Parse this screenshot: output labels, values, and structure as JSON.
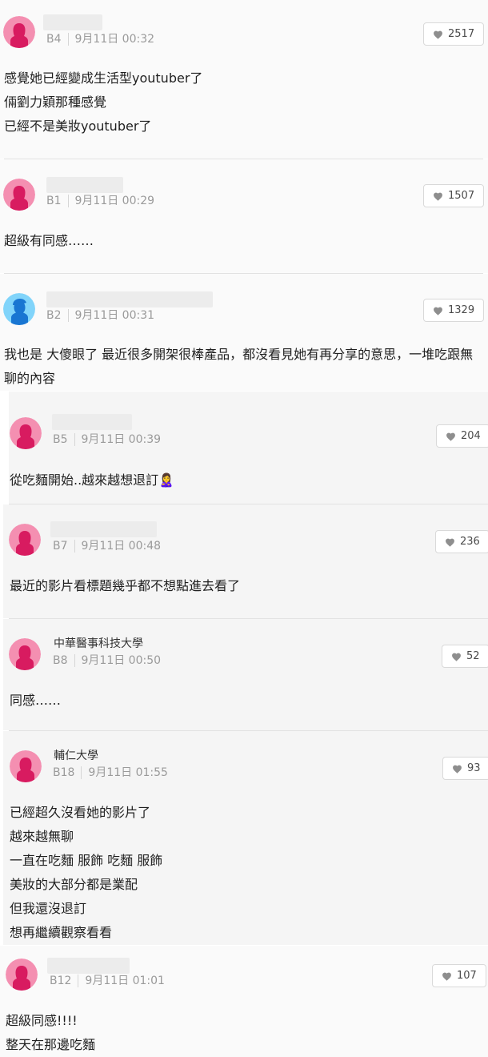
{
  "comments": [
    {
      "author": "",
      "floor": "B4",
      "time": "9月11日 00:32",
      "likes": "2517",
      "avatar": "female-avatar-icon",
      "text": "感覺她已經變成生活型youtuber了\n倆劉力穎那種感覺\n已經不是美妝youtuber了"
    },
    {
      "author": "",
      "floor": "B1",
      "time": "9月11日 00:29",
      "likes": "1507",
      "avatar": "female-avatar-icon",
      "text": "超級有同感……"
    },
    {
      "author": "",
      "floor": "B2",
      "time": "9月11日 00:31",
      "likes": "1329",
      "avatar": "male-avatar-icon",
      "text": "我也是 大傻眼了 最近很多開架很棒產品，都沒看見她有再分享的意思，一堆吃跟無聊的內容"
    },
    {
      "author": "",
      "floor": "B5",
      "time": "9月11日 00:39",
      "likes": "204",
      "avatar": "female-avatar-icon",
      "text": "從吃麵開始..越來越想退訂🙎‍♀️"
    },
    {
      "author": "",
      "floor": "B7",
      "time": "9月11日 00:48",
      "likes": "236",
      "avatar": "female-avatar-icon",
      "text": "最近的影片看標題幾乎都不想點進去看了"
    },
    {
      "author": "中華醫事科技大學",
      "floor": "B8",
      "time": "9月11日 00:50",
      "likes": "52",
      "avatar": "female-avatar-icon",
      "text": "同感……"
    },
    {
      "author": "輔仁大學",
      "floor": "B18",
      "time": "9月11日 01:55",
      "likes": "93",
      "avatar": "female-avatar-icon",
      "text": "已經超久沒看她的影片了\n越來越無聊\n一直在吃麵 服飾 吃麵 服飾\n美妝的大部分都是業配\n但我還沒退訂\n想再繼續觀察看看"
    },
    {
      "author": "",
      "floor": "B12",
      "time": "9月11日 01:01",
      "likes": "107",
      "avatar": "female-avatar-icon",
      "text": "超級同感!!!!\n整天在那邊吃麵"
    }
  ],
  "colors": {
    "female_avatar_bg": "#f48fb1",
    "female_avatar_fg": "#d81b60",
    "male_avatar_bg": "#81d4fa",
    "male_avatar_fg": "#1976d2"
  }
}
